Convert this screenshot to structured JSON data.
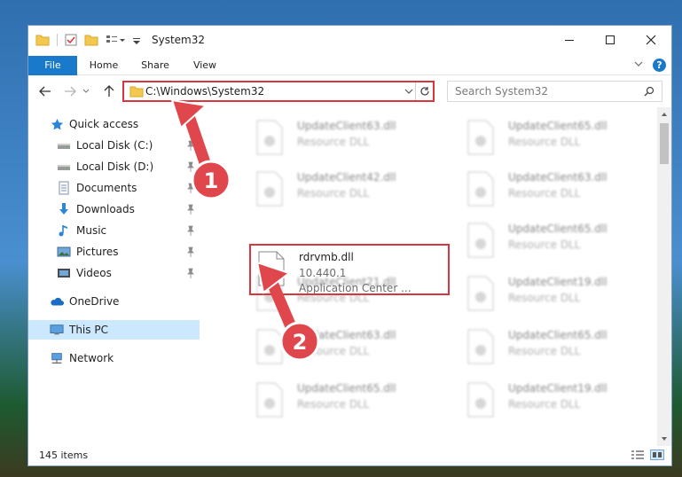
{
  "window": {
    "title": "System32",
    "controls": {
      "minimize": "minimize",
      "maximize": "maximize",
      "close": "close"
    }
  },
  "ribbon": {
    "tabs": [
      "File",
      "Home",
      "Share",
      "View"
    ],
    "help_label": "?"
  },
  "address": {
    "path": "C:\\Windows\\System32",
    "search_placeholder": "Search System32"
  },
  "navigation": {
    "items": [
      {
        "label": "Quick access",
        "icon": "star-icon",
        "pinned": false
      },
      {
        "label": "Local Disk (C:)",
        "icon": "drive-icon",
        "pinned": true
      },
      {
        "label": "Local Disk (D:)",
        "icon": "drive-icon",
        "pinned": true
      },
      {
        "label": "Documents",
        "icon": "documents-icon",
        "pinned": true
      },
      {
        "label": "Downloads",
        "icon": "download-icon",
        "pinned": true
      },
      {
        "label": "Music",
        "icon": "music-icon",
        "pinned": true
      },
      {
        "label": "Pictures",
        "icon": "pictures-icon",
        "pinned": true
      },
      {
        "label": "Videos",
        "icon": "videos-icon",
        "pinned": true
      },
      {
        "label": "OneDrive",
        "icon": "cloud-icon",
        "pinned": false
      },
      {
        "label": "This PC",
        "icon": "computer-icon",
        "pinned": false,
        "selected": true
      },
      {
        "label": "Network",
        "icon": "network-icon",
        "pinned": false
      }
    ]
  },
  "files": {
    "items": [
      {
        "name": "UpdateClient63.dll",
        "type": "Resource DLL"
      },
      {
        "name": "UpdateClient65.dll",
        "type": "Resource DLL"
      },
      {
        "name": "UpdateClient42.dll",
        "type": "Resource DLL"
      },
      {
        "name": "UpdateClient63.dll",
        "type": "Resource DLL"
      },
      {
        "name": "UpdateClient65.dll",
        "type": "Resource DLL"
      },
      {
        "name": "UpdateClient21.dll",
        "type": "Resource DLL"
      },
      {
        "name": "UpdateClient19.dll",
        "type": "Resource DLL"
      },
      {
        "name": "UpdateClient63.dll",
        "type": "Resource DLL"
      },
      {
        "name": "UpdateClient65.dll",
        "type": "Resource DLL"
      },
      {
        "name": "UpdateClient65.dll",
        "type": "Resource DLL"
      },
      {
        "name": "UpdateClient19.dll",
        "type": "Resource DLL"
      }
    ],
    "highlighted": {
      "name": "rdrvmb.dll",
      "version": "10.440.1",
      "description": "Application Center ..."
    }
  },
  "status": {
    "item_count": "145 items"
  },
  "annotations": {
    "step1": "1",
    "step2": "2",
    "color": "#e0474c"
  }
}
